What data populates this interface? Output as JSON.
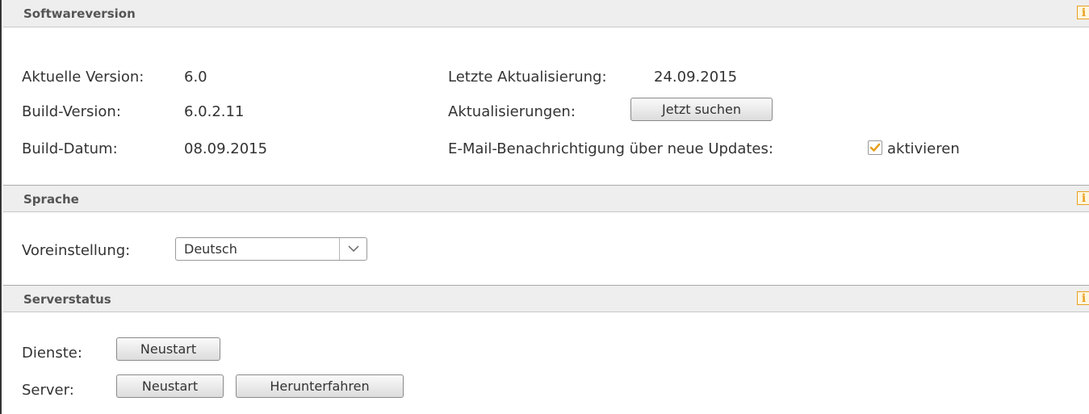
{
  "sections": {
    "software": {
      "title": "Softwareversion",
      "current_version_label": "Aktuelle Version:",
      "current_version_value": "6.0",
      "build_version_label": "Build-Version:",
      "build_version_value": "6.0.2.11",
      "build_date_label": "Build-Datum:",
      "build_date_value": "08.09.2015",
      "last_update_label": "Letzte Aktualisierung:",
      "last_update_value": "24.09.2015",
      "updates_label": "Aktualisierungen:",
      "search_button": "Jetzt suchen",
      "email_notify_label": "E-Mail-Benachrichtigung über neue Updates:",
      "email_notify_checkbox_label": "aktivieren",
      "email_notify_checked": true
    },
    "language": {
      "title": "Sprache",
      "default_label": "Voreinstellung:",
      "selected_language": "Deutsch"
    },
    "server": {
      "title": "Serverstatus",
      "services_label": "Dienste:",
      "services_restart_button": "Neustart",
      "server_label": "Server:",
      "server_restart_button": "Neustart",
      "server_shutdown_button": "Herunterfahren"
    }
  },
  "icons": {
    "info": "i"
  },
  "colors": {
    "accent": "#e8a020",
    "header_bg": "#eeeeee",
    "text": "#333333"
  }
}
